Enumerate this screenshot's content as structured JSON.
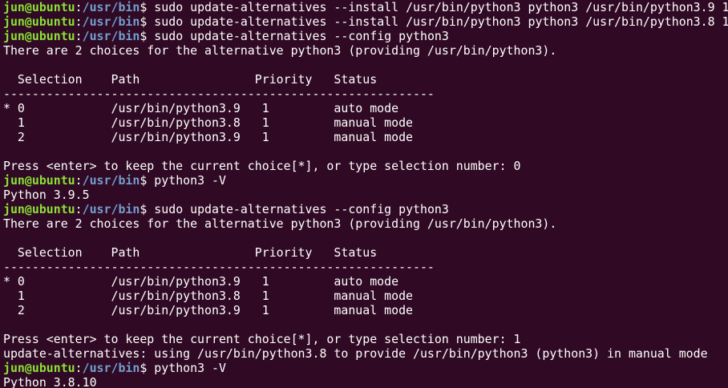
{
  "terminal": {
    "user_host": "jun@ubuntu",
    "colon": ":",
    "cwd": "/usr/bin",
    "dollar": "$ ",
    "lines": [
      {
        "type": "prompt",
        "cmd": "sudo update-alternatives --install /usr/bin/python3 python3 /usr/bin/python3.9 1"
      },
      {
        "type": "prompt",
        "cmd": "sudo update-alternatives --install /usr/bin/python3 python3 /usr/bin/python3.8 1"
      },
      {
        "type": "prompt",
        "cmd": "sudo update-alternatives --config python3"
      },
      {
        "type": "output",
        "text": "There are 2 choices for the alternative python3 (providing /usr/bin/python3)."
      },
      {
        "type": "output",
        "text": ""
      },
      {
        "type": "output",
        "text": "  Selection    Path                Priority   Status"
      },
      {
        "type": "output",
        "text": "------------------------------------------------------------"
      },
      {
        "type": "output",
        "text": "* 0            /usr/bin/python3.9   1         auto mode"
      },
      {
        "type": "output",
        "text": "  1            /usr/bin/python3.8   1         manual mode"
      },
      {
        "type": "output",
        "text": "  2            /usr/bin/python3.9   1         manual mode"
      },
      {
        "type": "output",
        "text": ""
      },
      {
        "type": "output",
        "text": "Press <enter> to keep the current choice[*], or type selection number: 0"
      },
      {
        "type": "prompt",
        "cmd": "python3 -V"
      },
      {
        "type": "output",
        "text": "Python 3.9.5"
      },
      {
        "type": "prompt",
        "cmd": "sudo update-alternatives --config python3"
      },
      {
        "type": "output",
        "text": "There are 2 choices for the alternative python3 (providing /usr/bin/python3)."
      },
      {
        "type": "output",
        "text": ""
      },
      {
        "type": "output",
        "text": "  Selection    Path                Priority   Status"
      },
      {
        "type": "output",
        "text": "------------------------------------------------------------"
      },
      {
        "type": "output",
        "text": "* 0            /usr/bin/python3.9   1         auto mode"
      },
      {
        "type": "output",
        "text": "  1            /usr/bin/python3.8   1         manual mode"
      },
      {
        "type": "output",
        "text": "  2            /usr/bin/python3.9   1         manual mode"
      },
      {
        "type": "output",
        "text": ""
      },
      {
        "type": "output",
        "text": "Press <enter> to keep the current choice[*], or type selection number: 1"
      },
      {
        "type": "output",
        "text": "update-alternatives: using /usr/bin/python3.8 to provide /usr/bin/python3 (python3) in manual mode"
      },
      {
        "type": "prompt",
        "cmd": "python3 -V"
      },
      {
        "type": "output",
        "text": "Python 3.8.10"
      }
    ]
  },
  "colors": {
    "background": "#300a24",
    "user_host": "#8ae234",
    "cwd": "#729fcf",
    "text": "#ffffff"
  }
}
